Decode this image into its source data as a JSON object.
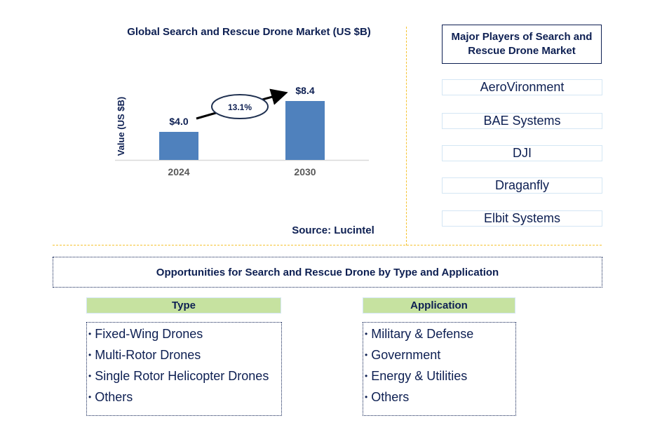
{
  "chart_data": {
    "type": "bar",
    "title": "Global Search and Rescue Drone Market (US $B)",
    "xlabel": "",
    "ylabel": "Value (US $B)",
    "categories": [
      "2024",
      "2030"
    ],
    "values": [
      4.0,
      8.4
    ],
    "value_labels": [
      "$4.0",
      "$8.4"
    ],
    "ylim": [
      0,
      10
    ],
    "grid": false,
    "bar_color": "#4f81bd",
    "annotation": {
      "type": "cagr-arrow",
      "label": "13.1%",
      "from": "2024",
      "to": "2030"
    }
  },
  "source": "Source: Lucintel",
  "players": {
    "title": "Major Players of Search and Rescue Drone Market",
    "items": [
      "AeroVironment",
      "BAE Systems",
      "DJI",
      "Draganfly",
      "Elbit Systems"
    ]
  },
  "opportunities": {
    "title": "Opportunities for Search and Rescue Drone by Type and Application",
    "type": {
      "header": "Type",
      "items": [
        "Fixed-Wing Drones",
        "Multi-Rotor Drones",
        "Single Rotor Helicopter Drones",
        "Others"
      ]
    },
    "application": {
      "header": "Application",
      "items": [
        "Military & Defense",
        "Government",
        "Energy & Utilities",
        "Others"
      ]
    }
  },
  "colors": {
    "text_navy": "#0d1f52",
    "divider_gold": "#f5c331",
    "segment_header_green": "#c6e2a0",
    "player_border": "#d4e6f4"
  }
}
